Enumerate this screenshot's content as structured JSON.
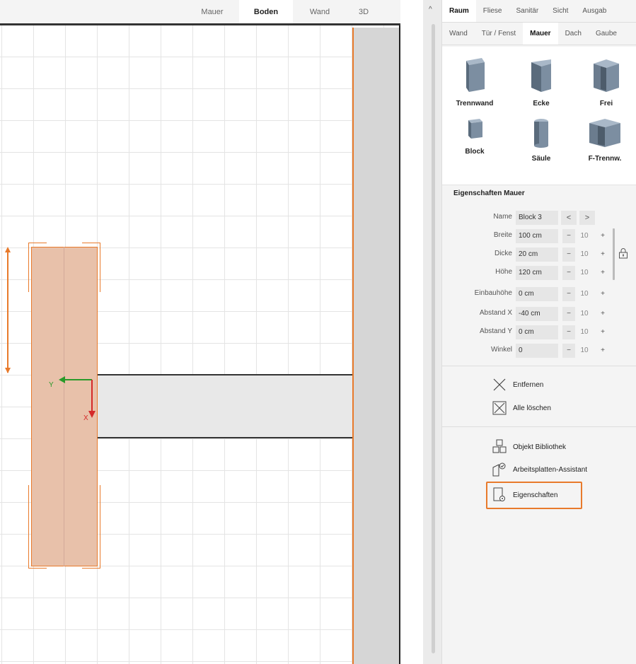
{
  "colors": {
    "accent": "#e87a2b",
    "selection_fill": "#e8c1aa",
    "wall_gray": "#d6d6d6",
    "axis_x": "#d42a2a",
    "axis_y": "#2a9a2a"
  },
  "view_tabs": [
    "Mauer",
    "Boden",
    "Wand",
    "3D"
  ],
  "view_tabs_active": "Boden",
  "canvas": {
    "axis_y_label": "Y",
    "axis_x_label": "X"
  },
  "panel": {
    "main_tabs": [
      "Raum",
      "Fliese",
      "Sanitär",
      "Sicht",
      "Ausgab"
    ],
    "sub_tabs": [
      "Wand",
      "Tür / Fenst",
      "Mauer",
      "Dach",
      "Gaube"
    ],
    "objects": [
      {
        "label": "Trennwand",
        "icon": "trennwand-icon"
      },
      {
        "label": "Ecke",
        "icon": "ecke-icon"
      },
      {
        "label": "Frei",
        "icon": "frei-icon"
      },
      {
        "label": "Block",
        "icon": "block-icon"
      },
      {
        "label": "Säule",
        "icon": "saeule-icon"
      },
      {
        "label": "F-Trennw.",
        "icon": "f-trennwand-icon"
      }
    ],
    "properties_title": "Eigenschaften Mauer",
    "name_label": "Name",
    "name_value": "Block 3",
    "nav_prev": "<",
    "nav_next": ">",
    "properties": [
      {
        "label": "Breite",
        "value": "100 cm",
        "step": "10"
      },
      {
        "label": "Dicke",
        "value": "20 cm",
        "step": "10"
      },
      {
        "label": "Höhe",
        "value": "120 cm",
        "step": "10"
      },
      {
        "label": "Einbauhöhe",
        "value": "0 cm",
        "step": "10"
      },
      {
        "label": "Abstand X",
        "value": "-40 cm",
        "step": "10"
      },
      {
        "label": "Abstand Y",
        "value": "0 cm",
        "step": "10"
      },
      {
        "label": "Winkel",
        "value": "0",
        "step": "10"
      }
    ],
    "minus": "−",
    "plus": "+",
    "actions": [
      {
        "label": "Entfernen",
        "icon": "close-x-icon"
      },
      {
        "label": "Alle löschen",
        "icon": "delete-all-icon"
      },
      {
        "label": "Objekt Bibliothek",
        "icon": "object-library-icon"
      },
      {
        "label": "Arbeitsplatten-Assistant",
        "icon": "worktop-assistant-icon"
      },
      {
        "label": "Eigenschaften",
        "icon": "properties-icon"
      }
    ]
  }
}
